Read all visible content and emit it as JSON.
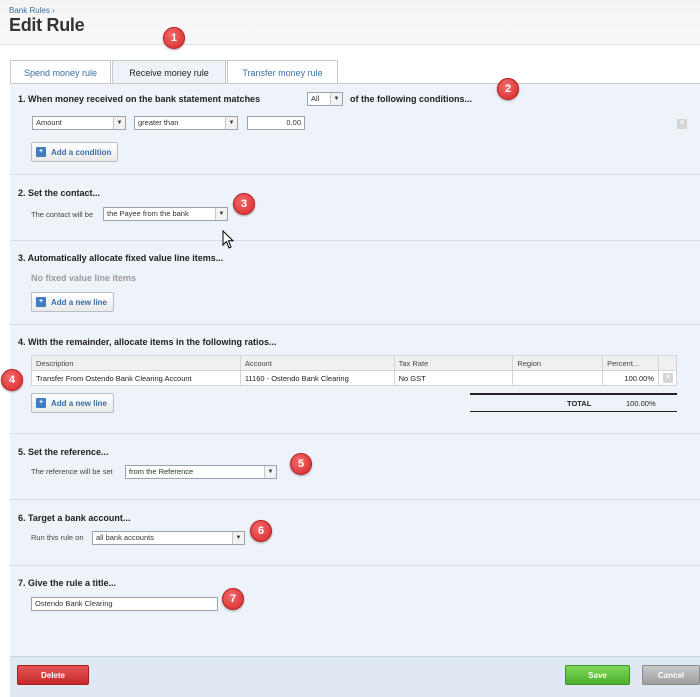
{
  "header": {
    "breadcrumb": "Bank Rules ›",
    "title": "Edit Rule"
  },
  "tabs": [
    {
      "label": "Spend money rule",
      "active": false
    },
    {
      "label": "Receive money rule",
      "active": true
    },
    {
      "label": "Transfer money rule",
      "active": false
    }
  ],
  "section1": {
    "title_before": "1.  When money received on the bank statement matches",
    "match_select": "All",
    "title_after": "of the following conditions...",
    "condition": {
      "field": "Amount",
      "operator": "greater than",
      "value": "0.00"
    },
    "add_condition_label": "Add a condition"
  },
  "section2": {
    "title": "2.  Set the contact...",
    "label": "The contact will be",
    "contact_select": "the Payee from the bank"
  },
  "section3": {
    "title": "3.  Automatically allocate fixed value line items...",
    "empty_text": "No fixed value line items",
    "add_line_label": "Add a new line"
  },
  "section4": {
    "title": "4.  With the remainder, allocate items in the following ratios...",
    "columns": [
      "Description",
      "Account",
      "Tax Rate",
      "Region",
      "Percent..."
    ],
    "rows": [
      {
        "description": "Transfer From Ostendo Bank Clearing Account",
        "account": "11160 - Ostendo Bank Clearing",
        "tax_rate": "No GST",
        "region": "",
        "percent": "100.00%"
      }
    ],
    "add_line_label": "Add a new line",
    "total_label": "TOTAL",
    "total_value": "100.00%"
  },
  "section5": {
    "title": "5.  Set the reference...",
    "label": "The reference will be set",
    "reference_select": "from the Reference"
  },
  "section6": {
    "title": "6.  Target a bank account...",
    "label": "Run this rule on",
    "account_select": "all bank accounts"
  },
  "section7": {
    "title": "7.  Give the rule a title...",
    "rule_title": "Ostendo Bank Clearing"
  },
  "footer": {
    "delete_label": "Delete",
    "save_label": "Save",
    "cancel_label": "Cancel"
  },
  "markers": [
    "1",
    "2",
    "3",
    "4",
    "5",
    "6",
    "7"
  ],
  "colors": {
    "marker": "#d6262a",
    "save": "#4caf2f",
    "delete": "#c62828",
    "link": "#3a6ea5",
    "panel": "#eef3fa"
  }
}
